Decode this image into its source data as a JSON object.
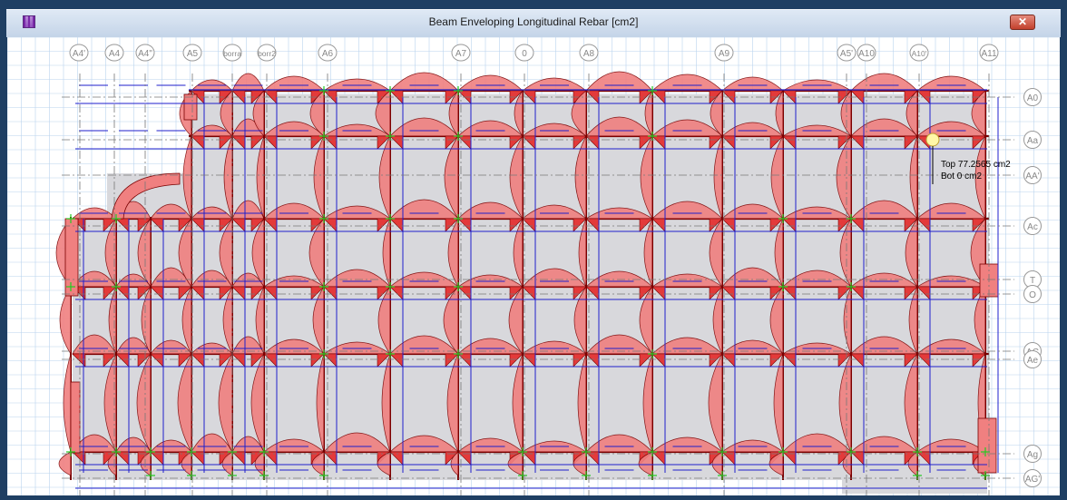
{
  "window": {
    "title": "Beam Enveloping Longitudinal Rebar  [cm2]",
    "close_glyph": "✕"
  },
  "icons": {
    "app": "etabs-app-icon",
    "close": "close-icon"
  },
  "colors": {
    "beam_fill": "#f08080",
    "slab": "#d8d8dc",
    "grid": "#b9d4ee",
    "rebar_line": "#1f1fcc",
    "support": "#22cc22",
    "beam_line": "#7a0000"
  },
  "top_grid_labels": [
    "A4'",
    "A4",
    "A4\"",
    "A5",
    "borra",
    "borr2",
    "A6",
    "A7",
    "0",
    "A8",
    "A9",
    "A5'",
    "A10",
    "A10'",
    "A11"
  ],
  "right_grid_labels": [
    "A0",
    "Aa",
    "AA'",
    "Ac",
    "T",
    "O",
    "AC",
    "Ae",
    "Ag",
    "AG'"
  ],
  "tooltip": {
    "top": "Top 77.2565 cm2",
    "bot": "Bot 0 cm2"
  }
}
